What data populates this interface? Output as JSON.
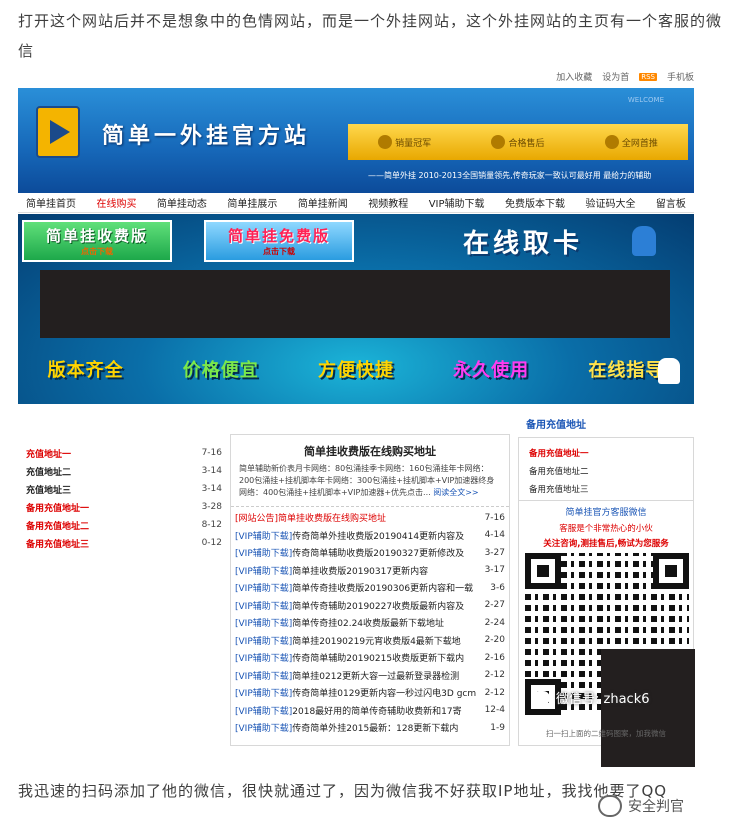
{
  "article": {
    "para_top": "打开这个网站后并不是想象中的色情网站，而是一个外挂网站，这个外挂网站的主页有一个客服的微信",
    "para_bottom": "我迅速的扫码添加了他的微信，很快就通过了，因为微信我不好获取IP地址，我找他要了QQ"
  },
  "site": {
    "toplinks": {
      "bookmark": "加入收藏",
      "homepage": "设为首",
      "rss": "RSS",
      "mobile": "手机板"
    },
    "banner": {
      "title": "简单一外挂官方站",
      "badges": [
        "销量冠军",
        "合格售后",
        "全网首推"
      ],
      "badge_sub": "BEST CHOICE",
      "slogan": "——简单外挂 2010-2013全国销量领先,传奇玩家一致认可最好用 最给力的辅助",
      "corner": "WELCOME"
    },
    "nav": [
      "简单挂首页",
      "在线购买",
      "简单挂动态",
      "简单挂展示",
      "简单挂新闻",
      "视频教程",
      "VIP辅助下载",
      "免费版本下载",
      "验证码大全",
      "留言板"
    ],
    "promo": {
      "paid": {
        "main": "简单挂收费版",
        "sub": "点击下载"
      },
      "free": {
        "main": "简单挂免费版",
        "sub": "点击下载"
      },
      "online": "在线取卡",
      "features": [
        "版本齐全",
        "价格便宜",
        "方便快捷",
        "永久使用",
        "在线指导"
      ]
    },
    "left_list": [
      {
        "label": "充值地址一",
        "num": "7-16",
        "color": "red"
      },
      {
        "label": "充值地址二",
        "num": "3-14",
        "color": "black"
      },
      {
        "label": "充值地址三",
        "num": "3-14",
        "color": "black"
      },
      {
        "label": "备用充值地址一",
        "num": "3-28",
        "color": "red"
      },
      {
        "label": "备用充值地址二",
        "num": "8-12",
        "color": "red"
      },
      {
        "label": "备用充值地址三",
        "num": "0-12",
        "color": "red"
      }
    ],
    "center": {
      "title": "简单挂收费版在线购买地址",
      "desc": "简单辅助新价表月卡网络：80包涌挂季卡网络：160包涌挂年卡网络：200包涌挂+挂机脚本年卡网络：300包涌挂+挂机脚本+VIP加速器终身网络：400包涌挂+挂机脚本+VIP加速器+优先点击...",
      "more": "阅读全文>>",
      "news": [
        {
          "tag": "[网站公告]",
          "title": "简单挂收费版在线购买地址",
          "date": "7-16",
          "red": true
        },
        {
          "tag": "[VIP辅助下载]",
          "title": "传奇简单外挂收费版20190414更新内容及",
          "date": "4-14",
          "red": false
        },
        {
          "tag": "[VIP辅助下载]",
          "title": "传奇简单辅助收费版20190327更新修改及",
          "date": "3-27",
          "red": false
        },
        {
          "tag": "[VIP辅助下载]",
          "title": "简单挂收费版20190317更新内容",
          "date": "3-17",
          "red": false
        },
        {
          "tag": "[VIP辅助下载]",
          "title": "简单传奇挂收费版20190306更新内容和一载",
          "date": "3-6",
          "red": false
        },
        {
          "tag": "[VIP辅助下载]",
          "title": "简单传奇辅助20190227收费版最新内容及",
          "date": "2-27",
          "red": false
        },
        {
          "tag": "[VIP辅助下载]",
          "title": "简单传奇挂02.24收费版最新下载地址",
          "date": "2-24",
          "red": false
        },
        {
          "tag": "[VIP辅助下载]",
          "title": "简单挂20190219元宵收费版4最新下载地",
          "date": "2-20",
          "red": false
        },
        {
          "tag": "[VIP辅助下载]",
          "title": "传奇简单辅助20190215收费版更新下载内",
          "date": "2-16",
          "red": false
        },
        {
          "tag": "[VIP辅助下载]",
          "title": "简单挂0212更新大容一过最新登录器检测",
          "date": "2-12",
          "red": false
        },
        {
          "tag": "[VIP辅助下载]",
          "title": "传奇简单挂0129更新内容一秒过闪电3D gcm",
          "date": "2-12",
          "red": false
        },
        {
          "tag": "[VIP辅助下载]",
          "title": "2018最好用的简单传奇辅助收费新和17寄",
          "date": "12-4",
          "red": false
        },
        {
          "tag": "[VIP辅助下载]",
          "title": "传奇简单外挂2015最新：128更新下载内",
          "date": "1-9",
          "red": false
        }
      ]
    },
    "right": {
      "head": "备用充值地址",
      "links": [
        {
          "label": "备用充值地址一",
          "color": "red"
        },
        {
          "label": "备用充值地址二",
          "color": "black"
        },
        {
          "label": "备用充值地址三",
          "color": "black"
        }
      ],
      "qr": {
        "title": "简单挂官方客服微信",
        "line2": "客服是个非常热心的小伙",
        "line3": "关注咨询,测挂售后,畅试为您服务",
        "caption": "扫一扫上面的二维码图案，加我微信",
        "wechat_label": "微信号: zhack6"
      }
    }
  },
  "signature": "安全判官"
}
